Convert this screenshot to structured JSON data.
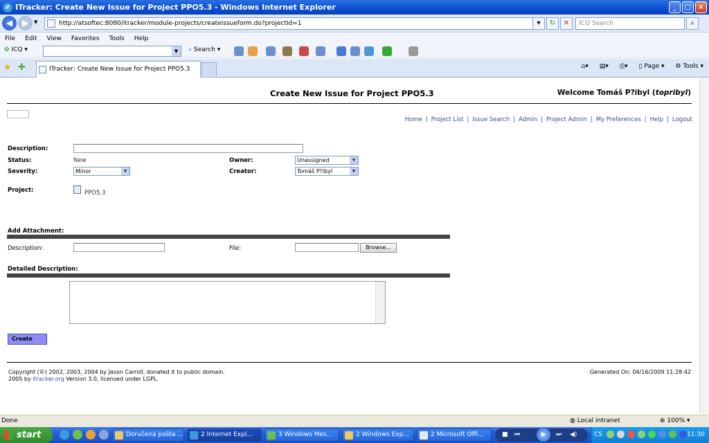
{
  "window": {
    "title": "ITracker: Create New Issue for Project PPO5.3 - Windows Internet Explorer"
  },
  "browser": {
    "address": "http://atsoftec:8080/itracker/module-projects/createissueform.do?projectId=1",
    "search_placeholder": "ICQ Search",
    "menu": [
      "File",
      "Edit",
      "View",
      "Favorites",
      "Tools",
      "Help"
    ],
    "icq_label": "ICQ",
    "search_label": "Search",
    "tab_title": "ITracker: Create New Issue for Project PPO5.3",
    "page_menu": "Page",
    "tools_menu": "Tools"
  },
  "page": {
    "title": "Create New Issue for Project PPO5.3",
    "welcome_prefix": "Welcome Tomáš P?ibyl (",
    "welcome_user": "topribyl",
    "welcome_suffix": ")",
    "nav_links": [
      "Home",
      "Project List",
      "Issue Search",
      "Admin",
      "Project Admin",
      "My Preferences",
      "Help",
      "Logout"
    ]
  },
  "form": {
    "description_label": "Description:",
    "description_value": "",
    "status_label": "Status:",
    "status_value": "New",
    "owner_label": "Owner:",
    "owner_value": "Unassigned",
    "severity_label": "Severity:",
    "severity_value": "Minor",
    "creator_label": "Creator:",
    "creator_value": "Tomáš P?ibyl",
    "project_label": "Project:",
    "project_value": "PPO5.3",
    "attachment_header": "Add Attachment:",
    "att_description_label": "Description:",
    "file_label": "File:",
    "browse_label": "Browse...",
    "detailed_header": "Detailed Description:",
    "create_label": "Create"
  },
  "footer": {
    "line1": "Copyright (©) 2002, 2003, 2004 by Jason Carroll, donated it to public domain.",
    "line2_prefix": "2005 by ",
    "line2_link": "itracker.org",
    "line2_suffix": " Version 3.0, licensed under LGPL.",
    "generated": "Generated On: 04/16/2009 11:28:42"
  },
  "statusbar": {
    "status": "Done",
    "zone": "Local intranet",
    "zoom": "100%"
  },
  "taskbar": {
    "start": "start",
    "tasks": [
      "Doručená pošta ...",
      "2 Internet Expl...",
      "3 Windows Mes...",
      "2 Windows Exp...",
      "2 Microsoft Offi..."
    ],
    "lang": "CS",
    "clock": "11:30"
  }
}
